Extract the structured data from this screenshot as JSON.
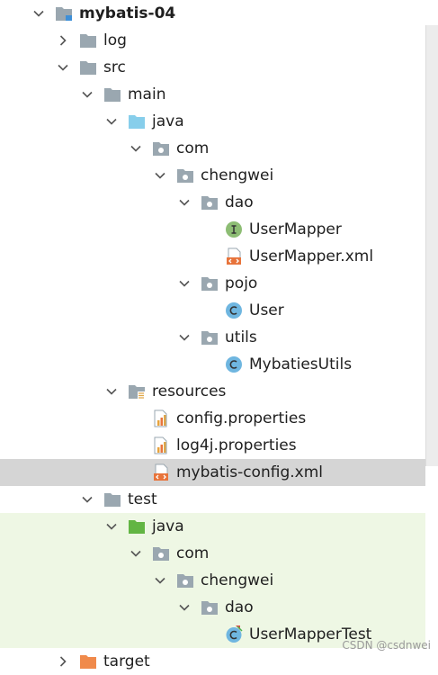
{
  "tree": [
    {
      "label": "mybatis-04",
      "depth": 0,
      "chevron": "down",
      "icon": "module-folder-icon",
      "bold": true
    },
    {
      "label": "log",
      "depth": 1,
      "chevron": "right",
      "icon": "folder-icon"
    },
    {
      "label": "src",
      "depth": 1,
      "chevron": "down",
      "icon": "folder-icon"
    },
    {
      "label": "main",
      "depth": 2,
      "chevron": "down",
      "icon": "folder-icon"
    },
    {
      "label": "java",
      "depth": 3,
      "chevron": "down",
      "icon": "source-root-folder-icon"
    },
    {
      "label": "com",
      "depth": 4,
      "chevron": "down",
      "icon": "package-icon"
    },
    {
      "label": "chengwei",
      "depth": 5,
      "chevron": "down",
      "icon": "package-icon"
    },
    {
      "label": "dao",
      "depth": 6,
      "chevron": "down",
      "icon": "package-icon"
    },
    {
      "label": "UserMapper",
      "depth": 7,
      "chevron": "none",
      "icon": "interface-icon"
    },
    {
      "label": "UserMapper.xml",
      "depth": 7,
      "chevron": "none",
      "icon": "xml-file-icon"
    },
    {
      "label": "pojo",
      "depth": 6,
      "chevron": "down",
      "icon": "package-icon"
    },
    {
      "label": "User",
      "depth": 7,
      "chevron": "none",
      "icon": "class-icon"
    },
    {
      "label": "utils",
      "depth": 6,
      "chevron": "down",
      "icon": "package-icon"
    },
    {
      "label": "MybatiesUtils",
      "depth": 7,
      "chevron": "none",
      "icon": "class-icon"
    },
    {
      "label": "resources",
      "depth": 3,
      "chevron": "down",
      "icon": "resources-folder-icon"
    },
    {
      "label": "config.properties",
      "depth": 4,
      "chevron": "none",
      "icon": "properties-file-icon"
    },
    {
      "label": "log4j.properties",
      "depth": 4,
      "chevron": "none",
      "icon": "properties-file-icon"
    },
    {
      "label": "mybatis-config.xml",
      "depth": 4,
      "chevron": "none",
      "icon": "xml-file-icon",
      "selected": true
    },
    {
      "label": "test",
      "depth": 2,
      "chevron": "down",
      "icon": "folder-icon"
    },
    {
      "label": "java",
      "depth": 3,
      "chevron": "down",
      "icon": "test-root-folder-icon",
      "test": true
    },
    {
      "label": "com",
      "depth": 4,
      "chevron": "down",
      "icon": "package-icon",
      "test": true
    },
    {
      "label": "chengwei",
      "depth": 5,
      "chevron": "down",
      "icon": "package-icon",
      "test": true
    },
    {
      "label": "dao",
      "depth": 6,
      "chevron": "down",
      "icon": "package-icon",
      "test": true
    },
    {
      "label": "UserMapperTest",
      "depth": 7,
      "chevron": "none",
      "icon": "test-class-icon",
      "test": true
    },
    {
      "label": "target",
      "depth": 1,
      "chevron": "right",
      "icon": "excluded-folder-icon"
    }
  ],
  "watermark": "CSDN @csdnwei",
  "colors": {
    "selection": "#d5d5d5",
    "test_background": "#eef7e4",
    "folder": "#9aa7b0",
    "source_root": "#87ceeb",
    "test_root": "#62b543",
    "excluded": "#f08a4b",
    "interface": "#8dbd74",
    "class": "#6fb6e0",
    "xml": "#e8743b"
  }
}
